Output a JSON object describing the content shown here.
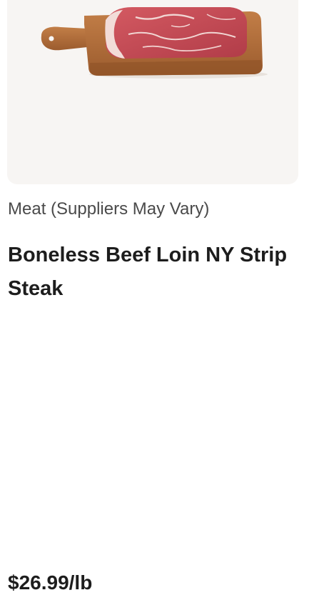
{
  "product": {
    "category": "Meat (Suppliers May Vary)",
    "name": "Boneless Beef Loin NY Strip Steak",
    "price": "$26.99/lb"
  },
  "colors": {
    "image_background": "#f7f5f3",
    "board": "#b06f3c",
    "meat": "#c94a55",
    "marbling": "#f1d6d3",
    "text_primary": "#1d1d1d",
    "text_secondary": "#4a4a4a"
  },
  "icons": {
    "product_image": "steak-on-cutting-board"
  }
}
